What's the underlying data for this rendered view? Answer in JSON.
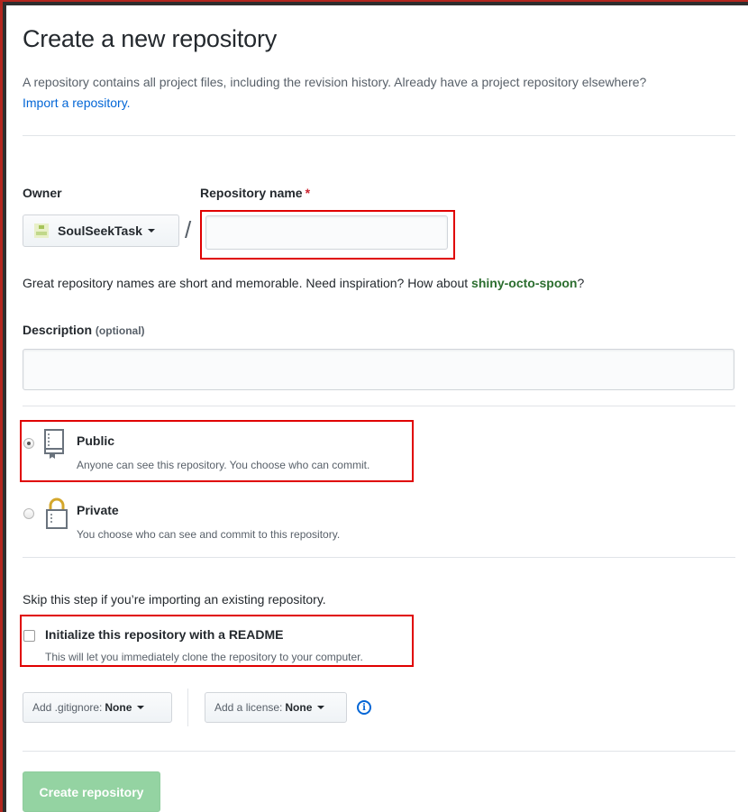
{
  "header": {
    "title": "Create a new repository",
    "description": "A repository contains all project files, including the revision history. Already have a project repository elsewhere?",
    "import_link": "Import a repository."
  },
  "owner": {
    "label": "Owner",
    "value": "SoulSeekTask"
  },
  "repo_name": {
    "label": "Repository name",
    "required_mark": "*",
    "value": "",
    "separator": "/"
  },
  "hint": {
    "prefix": "Great repository names are short and memorable. Need inspiration? How about ",
    "suggestion": "shiny-octo-spoon",
    "suffix": "?"
  },
  "description": {
    "label": "Description",
    "optional": "(optional)",
    "value": ""
  },
  "visibility": {
    "public": {
      "title": "Public",
      "desc": "Anyone can see this repository. You choose who can commit.",
      "selected": true
    },
    "private": {
      "title": "Private",
      "desc": "You choose who can see and commit to this repository.",
      "selected": false
    }
  },
  "init": {
    "skip_note": "Skip this step if you’re importing an existing repository.",
    "readme_label": "Initialize this repository with a README",
    "readme_desc": "This will let you immediately clone the repository to your computer.",
    "readme_checked": false
  },
  "extras": {
    "gitignore_label": "Add .gitignore:",
    "gitignore_value": "None",
    "license_label": "Add a license:",
    "license_value": "None"
  },
  "submit": {
    "label": "Create repository"
  },
  "colors": {
    "highlight": "#e00000",
    "link": "#0366d6",
    "create_button": "#94d3a2"
  }
}
